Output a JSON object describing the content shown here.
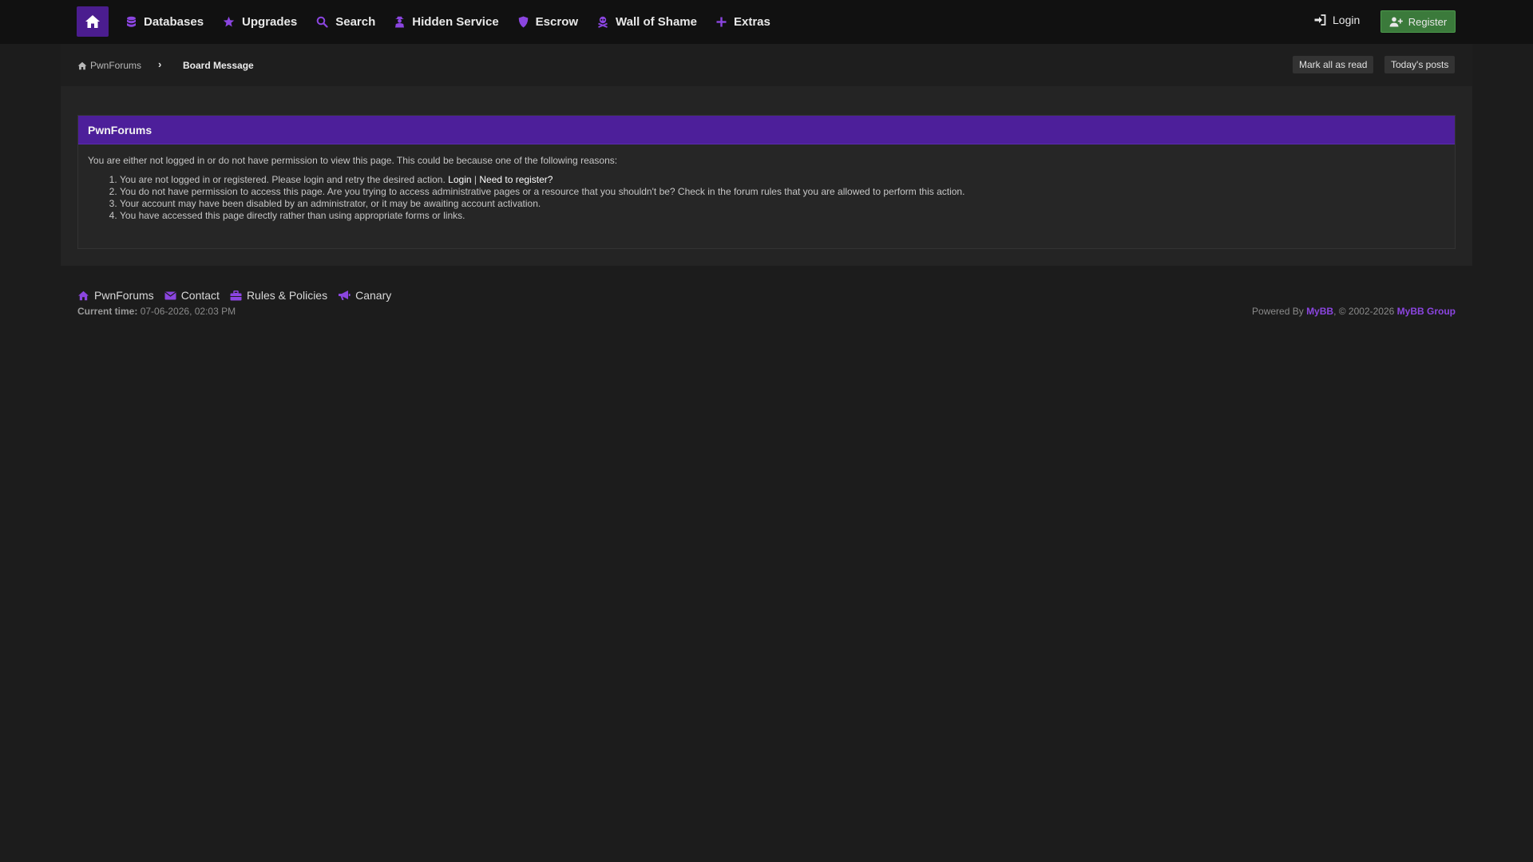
{
  "nav": {
    "home_icon": "home-icon",
    "items": [
      {
        "label": "Databases",
        "icon": "database-icon"
      },
      {
        "label": "Upgrades",
        "icon": "star-icon"
      },
      {
        "label": "Search",
        "icon": "search-icon"
      },
      {
        "label": "Hidden Service",
        "icon": "user-secret-icon"
      },
      {
        "label": "Escrow",
        "icon": "shield-icon"
      },
      {
        "label": "Wall of Shame",
        "icon": "skull-icon"
      },
      {
        "label": "Extras",
        "icon": "plus-icon"
      }
    ],
    "login_label": "Login",
    "register_label": "Register"
  },
  "breadcrumb": {
    "home_label": "PwnForums",
    "separator": "›",
    "current": "Board Message"
  },
  "actions": {
    "mark_read": "Mark all as read",
    "todays_posts": "Today's posts"
  },
  "panel": {
    "title": "PwnForums",
    "intro": "You are either not logged in or do not have permission to view this page. This could be because one of the following reasons:",
    "reason1_text": "You are not logged in or registered. Please login and retry the desired action.",
    "reason1_login": "Login",
    "reason1_pipe": "|",
    "reason1_register": "Need to register?",
    "reason2": "You do not have permission to access this page. Are you trying to access administrative pages or a resource that you shouldn't be? Check in the forum rules that you are allowed to perform this action.",
    "reason3": "Your account may have been disabled by an administrator, or it may be awaiting account activation.",
    "reason4": "You have accessed this page directly rather than using appropriate forms or links."
  },
  "footer": {
    "links": [
      {
        "label": "PwnForums",
        "icon": "home-icon"
      },
      {
        "label": "Contact",
        "icon": "envelope-icon"
      },
      {
        "label": "Rules & Policies",
        "icon": "briefcase-icon"
      },
      {
        "label": "Canary",
        "icon": "bullhorn-icon"
      }
    ],
    "current_time_label": "Current time:",
    "current_time_value": "07-06-2026, 02:03 PM",
    "powered_by": "Powered By",
    "mybb": "MyBB",
    "copyright": ", © 2002-2026",
    "mybb_group": "MyBB Group"
  },
  "colors": {
    "accent": "#4d1f9a",
    "link_purple": "#8b45e0",
    "register_green": "#3b7a3b",
    "background": "#1c1c1c"
  }
}
